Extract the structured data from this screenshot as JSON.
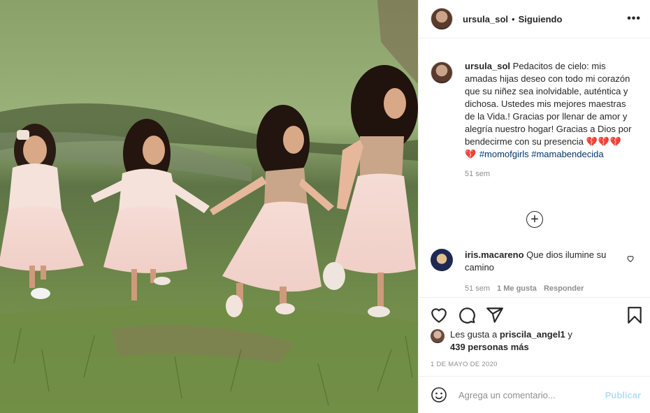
{
  "header": {
    "username": "ursula_sol",
    "separator": "•",
    "follow_status": "Siguiendo",
    "more_label": "•••"
  },
  "caption": {
    "username": "ursula_sol",
    "text": "Pedacitos de cielo: mis amadas hijas deseo con todo mi corazón que su niñez sea inolvidable, auténtica y dichosa. Ustedes mis mejores maestras de la Vida.! Gracias por llenar de amor y alegría nuestro hogar! Gracias a Dios por bendecirme con su presencia",
    "emoji": "💔💔💔💔",
    "hashtags": "#momofgirls #mamabendecida",
    "time": "51 sem"
  },
  "load_more_label": "+",
  "comment": {
    "username": "iris.macareno",
    "text": "Que dios ilumine su camino",
    "time": "51 sem",
    "likes": "1 Me gusta",
    "reply": "Responder"
  },
  "likes": {
    "prefix": "Les gusta a",
    "user": "priscila_angel1",
    "connector": "y",
    "others": "439 personas más"
  },
  "date": "1 DE MAYO DE 2020",
  "add_comment": {
    "placeholder": "Agrega un comentario...",
    "publish_label": "Publicar"
  },
  "icons": {
    "like": "heart-icon",
    "comment": "comment-icon",
    "share": "share-icon",
    "save": "bookmark-icon",
    "emoji": "emoji-icon"
  },
  "colors": {
    "link": "#00376b",
    "publish_disabled": "#b2dffc",
    "muted": "#8e8e8e"
  }
}
